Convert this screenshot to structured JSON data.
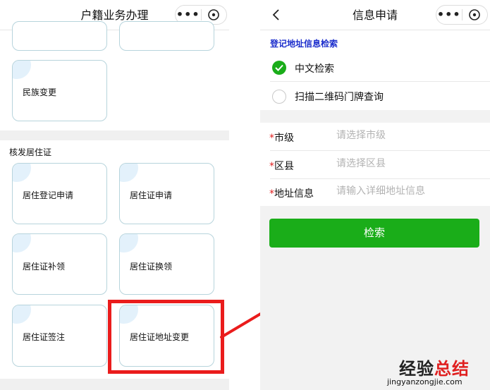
{
  "left": {
    "title": "户籍业务办理",
    "capsule": {
      "more": "•••",
      "close_icon": "close-circle-icon"
    },
    "cards_top": [
      "民族变更"
    ],
    "section": {
      "title": "核发居住证",
      "cards": [
        "居住登记申请",
        "居住证申请",
        "居住证补领",
        "居住证换领",
        "居住证签注",
        "居住证地址变更"
      ]
    }
  },
  "right": {
    "title": "信息申请",
    "capsule": {
      "more": "•••",
      "close_icon": "close-circle-icon"
    },
    "form_title": "登记地址信息检索",
    "options": [
      {
        "label": "中文检索",
        "checked": true
      },
      {
        "label": "扫描二维码门牌查询",
        "checked": false
      }
    ],
    "fields": [
      {
        "required": "*",
        "label": "市级",
        "placeholder": "请选择市级"
      },
      {
        "required": "*",
        "label": "区县",
        "placeholder": "请选择区县"
      },
      {
        "required": "*",
        "label": "地址信息",
        "placeholder": "请输入详细地址信息"
      }
    ],
    "search_label": "检索"
  },
  "watermark": {
    "main_dark": "经验",
    "main_red": "总结",
    "sub": "jingyanzongjie.com"
  },
  "colors": {
    "accent_green": "#1aad19",
    "highlight_red": "#ea1c1c",
    "form_title_blue": "#1b2dcc",
    "card_border": "#b7d4dc"
  }
}
